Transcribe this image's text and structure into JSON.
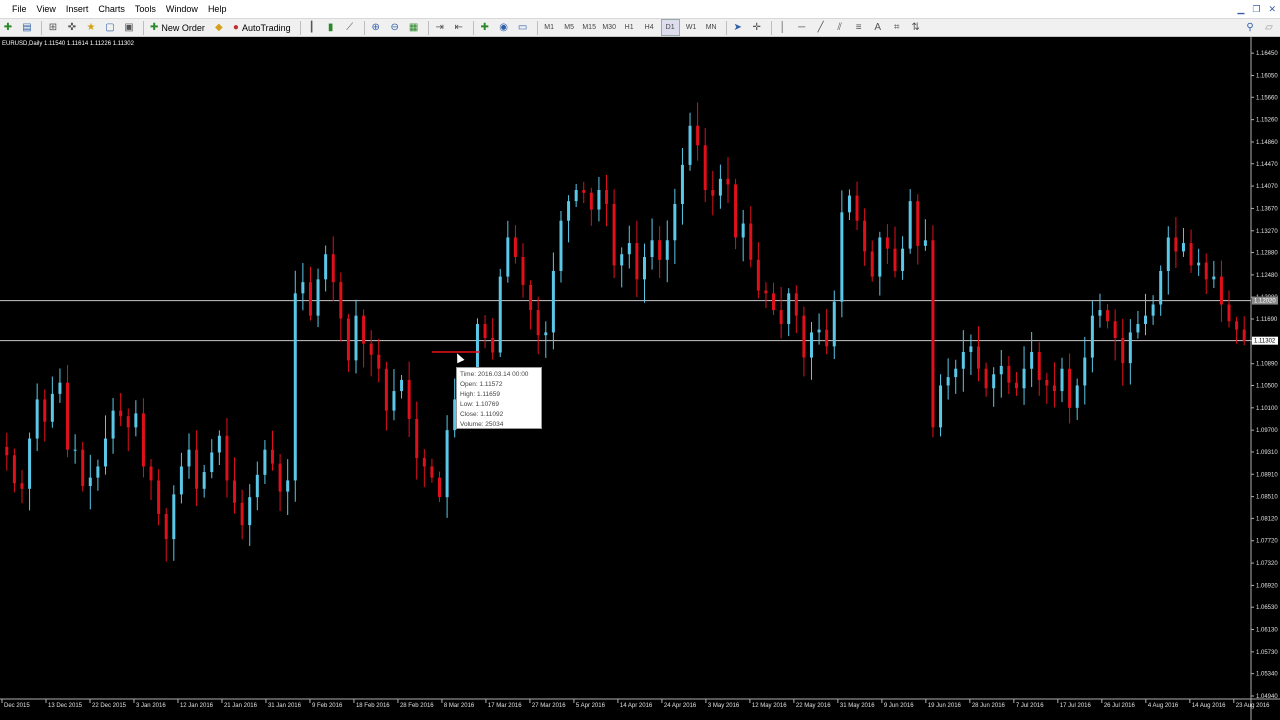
{
  "menu": {
    "items": [
      "File",
      "View",
      "Insert",
      "Charts",
      "Tools",
      "Window",
      "Help"
    ]
  },
  "toolbar": {
    "new_order_label": "New Order",
    "autotrading_label": "AutoTrading",
    "timeframes": [
      "M1",
      "M5",
      "M15",
      "M30",
      "H1",
      "H4",
      "D1",
      "W1",
      "MN"
    ],
    "active_timeframe": "D1"
  },
  "chart": {
    "info_line": "EURUSD,Daily  1.11540 1.11614 1.11226 1.11302",
    "bull_color": "#5bc8e8",
    "bear_color": "#e0101a",
    "hline_color": "#c8c8c8",
    "axis_color": "#b0b0b0"
  },
  "tooltip": {
    "time": "Time: 2016.03.14 00:00",
    "open": "Open:  1.11572",
    "high": "High:  1.11659",
    "low": "Low:   1.10769",
    "close": "Close:  1.11092",
    "volume": "Volume: 25034"
  },
  "chart_data": {
    "type": "candlestick",
    "symbol": "EURUSD",
    "timeframe": "Daily",
    "ylim": [
      1.0494,
      1.1665
    ],
    "y_ticks": [
      "1.16450",
      "1.16050",
      "1.15660",
      "1.15260",
      "1.14860",
      "1.14470",
      "1.14070",
      "1.13670",
      "1.13270",
      "1.12880",
      "1.12480",
      "1.12080",
      "1.11690",
      "1.11302",
      "1.10890",
      "1.10500",
      "1.10100",
      "1.09700",
      "1.09310",
      "1.08910",
      "1.08510",
      "1.08120",
      "1.07720",
      "1.07320",
      "1.06920",
      "1.06530",
      "1.06130",
      "1.05730",
      "1.05340",
      "1.04940"
    ],
    "x_ticks": [
      "Dec 2015",
      "13 Dec 2015",
      "22 Dec 2015",
      "3 Jan 2016",
      "12 Jan 2016",
      "21 Jan 2016",
      "31 Jan 2016",
      "9 Feb 2016",
      "18 Feb 2016",
      "28 Feb 2016",
      "8 Mar 2016",
      "17 Mar 2016",
      "27 Mar 2016",
      "5 Apr 2016",
      "14 Apr 2016",
      "24 Apr 2016",
      "3 May 2016",
      "12 May 2016",
      "22 May 2016",
      "31 May 2016",
      "9 Jun 2016",
      "19 Jun 2016",
      "28 Jun 2016",
      "7 Jul 2016",
      "17 Jul 2016",
      "26 Jul 2016",
      "4 Aug 2016",
      "14 Aug 2016",
      "23 Aug 2016"
    ],
    "horizontal_lines": [
      1.1202,
      1.11302
    ],
    "current_price": "1.11302",
    "bid_label": "1.12020",
    "candle_closes": [
      1.0925,
      1.0875,
      1.0865,
      1.0955,
      1.1025,
      1.0985,
      1.1035,
      1.1055,
      1.0935,
      1.0935,
      1.087,
      1.0885,
      1.0905,
      1.0955,
      1.1005,
      1.0995,
      1.0975,
      1.1,
      1.0905,
      1.088,
      1.082,
      1.0775,
      1.0855,
      1.0905,
      1.0935,
      1.0865,
      1.0895,
      1.093,
      1.096,
      1.088,
      1.084,
      1.08,
      1.085,
      1.089,
      1.0935,
      1.091,
      1.086,
      1.088,
      1.1215,
      1.1235,
      1.1175,
      1.124,
      1.1285,
      1.1235,
      1.117,
      1.1095,
      1.1175,
      1.1125,
      1.1105,
      1.108,
      1.1005,
      1.104,
      1.106,
      1.099,
      1.092,
      1.0905,
      1.0885,
      1.085,
      1.097,
      1.1025,
      1.105,
      1.102,
      1.116,
      1.1135,
      1.1109,
      1.1245,
      1.1315,
      1.128,
      1.123,
      1.1185,
      1.114,
      1.1145,
      1.1255,
      1.1345,
      1.138,
      1.14,
      1.1395,
      1.1365,
      1.14,
      1.1375,
      1.1265,
      1.1285,
      1.1305,
      1.124,
      1.128,
      1.131,
      1.1275,
      1.131,
      1.1375,
      1.1445,
      1.1515,
      1.148,
      1.14,
      1.139,
      1.142,
      1.141,
      1.1315,
      1.134,
      1.1275,
      1.122,
      1.1215,
      1.1185,
      1.116,
      1.1215,
      1.1175,
      1.11,
      1.1145,
      1.115,
      1.112,
      1.12,
      1.136,
      1.139,
      1.1345,
      1.129,
      1.1245,
      1.1315,
      1.1295,
      1.1255,
      1.1295,
      1.138,
      1.13,
      1.131,
      1.0975,
      1.105,
      1.1065,
      1.108,
      1.111,
      1.112,
      1.108,
      1.1045,
      1.107,
      1.1085,
      1.1055,
      1.1045,
      1.108,
      1.111,
      1.106,
      1.105,
      1.104,
      1.108,
      1.101,
      1.105,
      1.11,
      1.1175,
      1.1185,
      1.1165,
      1.1135,
      1.109,
      1.1145,
      1.116,
      1.1175,
      1.1195,
      1.1255,
      1.1315,
      1.129,
      1.1305,
      1.1265,
      1.127,
      1.124,
      1.1245,
      1.1195,
      1.1165,
      1.115,
      1.113
    ]
  }
}
